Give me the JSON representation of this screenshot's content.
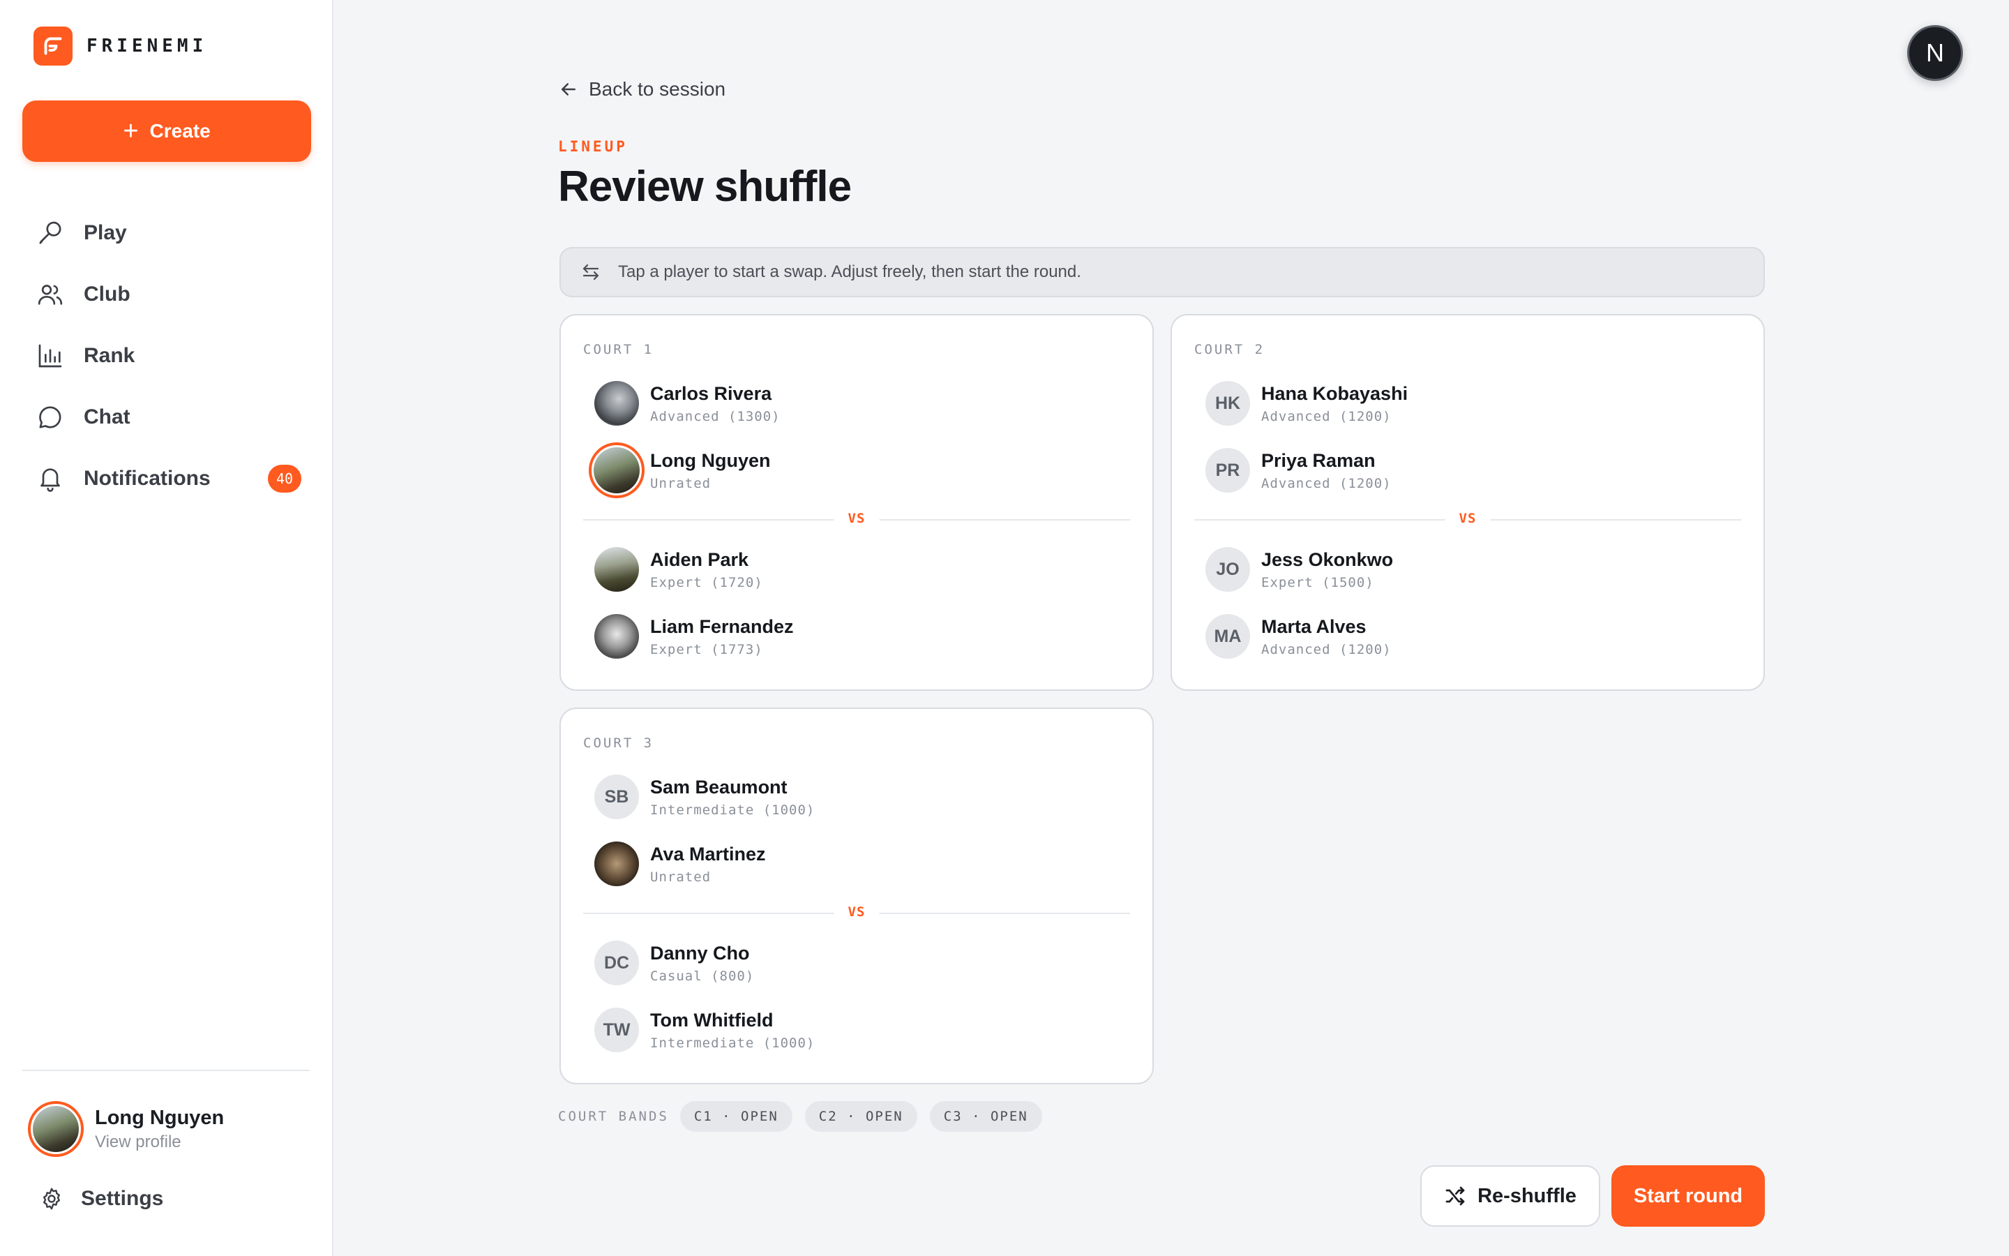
{
  "brand": {
    "name": "FRIENEMI"
  },
  "sidebar": {
    "create_label": "Create",
    "items": [
      {
        "label": "Play",
        "icon": "racket-icon"
      },
      {
        "label": "Club",
        "icon": "users-icon"
      },
      {
        "label": "Rank",
        "icon": "bar-chart-icon"
      },
      {
        "label": "Chat",
        "icon": "chat-bubble-icon"
      },
      {
        "label": "Notifications",
        "icon": "bell-icon",
        "badge": "40"
      }
    ],
    "profile": {
      "name": "Long Nguyen",
      "sub": "View profile"
    },
    "settings_label": "Settings"
  },
  "header": {
    "back_label": "Back to session",
    "eyebrow": "LINEUP",
    "title": "Review shuffle",
    "hint": "Tap a player to start a swap. Adjust freely, then start the round."
  },
  "vs_label": "VS",
  "courts": [
    {
      "label": "COURT 1",
      "players": [
        {
          "name": "Carlos Rivera",
          "level": "Advanced (1300)",
          "initials": ""
        },
        {
          "name": "Long Nguyen",
          "level": "Unrated",
          "initials": ""
        },
        {
          "name": "Aiden Park",
          "level": "Expert (1720)",
          "initials": ""
        },
        {
          "name": "Liam Fernandez",
          "level": "Expert (1773)",
          "initials": ""
        }
      ]
    },
    {
      "label": "COURT 2",
      "players": [
        {
          "name": "Hana Kobayashi",
          "level": "Advanced (1200)",
          "initials": "HK"
        },
        {
          "name": "Priya Raman",
          "level": "Advanced (1200)",
          "initials": "PR"
        },
        {
          "name": "Jess Okonkwo",
          "level": "Expert (1500)",
          "initials": "JO"
        },
        {
          "name": "Marta Alves",
          "level": "Advanced (1200)",
          "initials": "MA"
        }
      ]
    },
    {
      "label": "COURT 3",
      "players": [
        {
          "name": "Sam Beaumont",
          "level": "Intermediate (1000)",
          "initials": "SB"
        },
        {
          "name": "Ava Martinez",
          "level": "Unrated",
          "initials": ""
        },
        {
          "name": "Danny Cho",
          "level": "Casual (800)",
          "initials": "DC"
        },
        {
          "name": "Tom Whitfield",
          "level": "Intermediate (1000)",
          "initials": "TW"
        }
      ]
    }
  ],
  "bands": {
    "label": "COURT BANDS",
    "chips": [
      "C1 · OPEN",
      "C2 · OPEN",
      "C3 · OPEN"
    ]
  },
  "actions": {
    "reshuffle_label": "Re-shuffle",
    "start_label": "Start round"
  },
  "corner_avatar": {
    "letter": "N"
  },
  "colors": {
    "accent": "#ff5a1f",
    "background": "#f4f5f7"
  }
}
